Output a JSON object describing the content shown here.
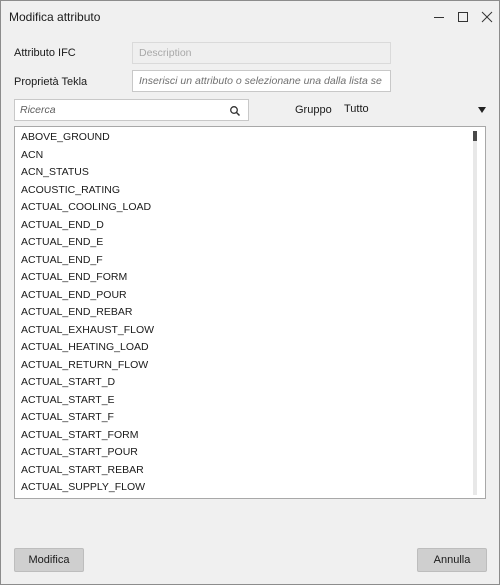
{
  "window": {
    "title": "Modifica attributo"
  },
  "form": {
    "ifc_label": "Attributo IFC",
    "ifc_value": "Description",
    "tekla_label": "Proprietà Tekla",
    "tekla_placeholder": "Inserisci un attributo o selezionane una dalla lista se"
  },
  "search": {
    "placeholder": "Ricerca"
  },
  "group": {
    "label": "Gruppo",
    "value": "Tutto"
  },
  "list": {
    "items": [
      "ABOVE_GROUND",
      "ACN",
      "ACN_STATUS",
      "ACOUSTIC_RATING",
      "ACTUAL_COOLING_LOAD",
      "ACTUAL_END_D",
      "ACTUAL_END_E",
      "ACTUAL_END_F",
      "ACTUAL_END_FORM",
      "ACTUAL_END_POUR",
      "ACTUAL_END_REBAR",
      "ACTUAL_EXHAUST_FLOW",
      "ACTUAL_HEATING_LOAD",
      "ACTUAL_RETURN_FLOW",
      "ACTUAL_START_D",
      "ACTUAL_START_E",
      "ACTUAL_START_F",
      "ACTUAL_START_FORM",
      "ACTUAL_START_POUR",
      "ACTUAL_START_REBAR",
      "ACTUAL_SUPPLY_FLOW"
    ]
  },
  "buttons": {
    "modify": "Modifica",
    "cancel": "Annulla"
  },
  "icons": {
    "minimize": "minimize-icon",
    "maximize": "maximize-icon",
    "close": "close-icon",
    "search": "search-icon",
    "dropdown": "chevron-down-icon"
  }
}
